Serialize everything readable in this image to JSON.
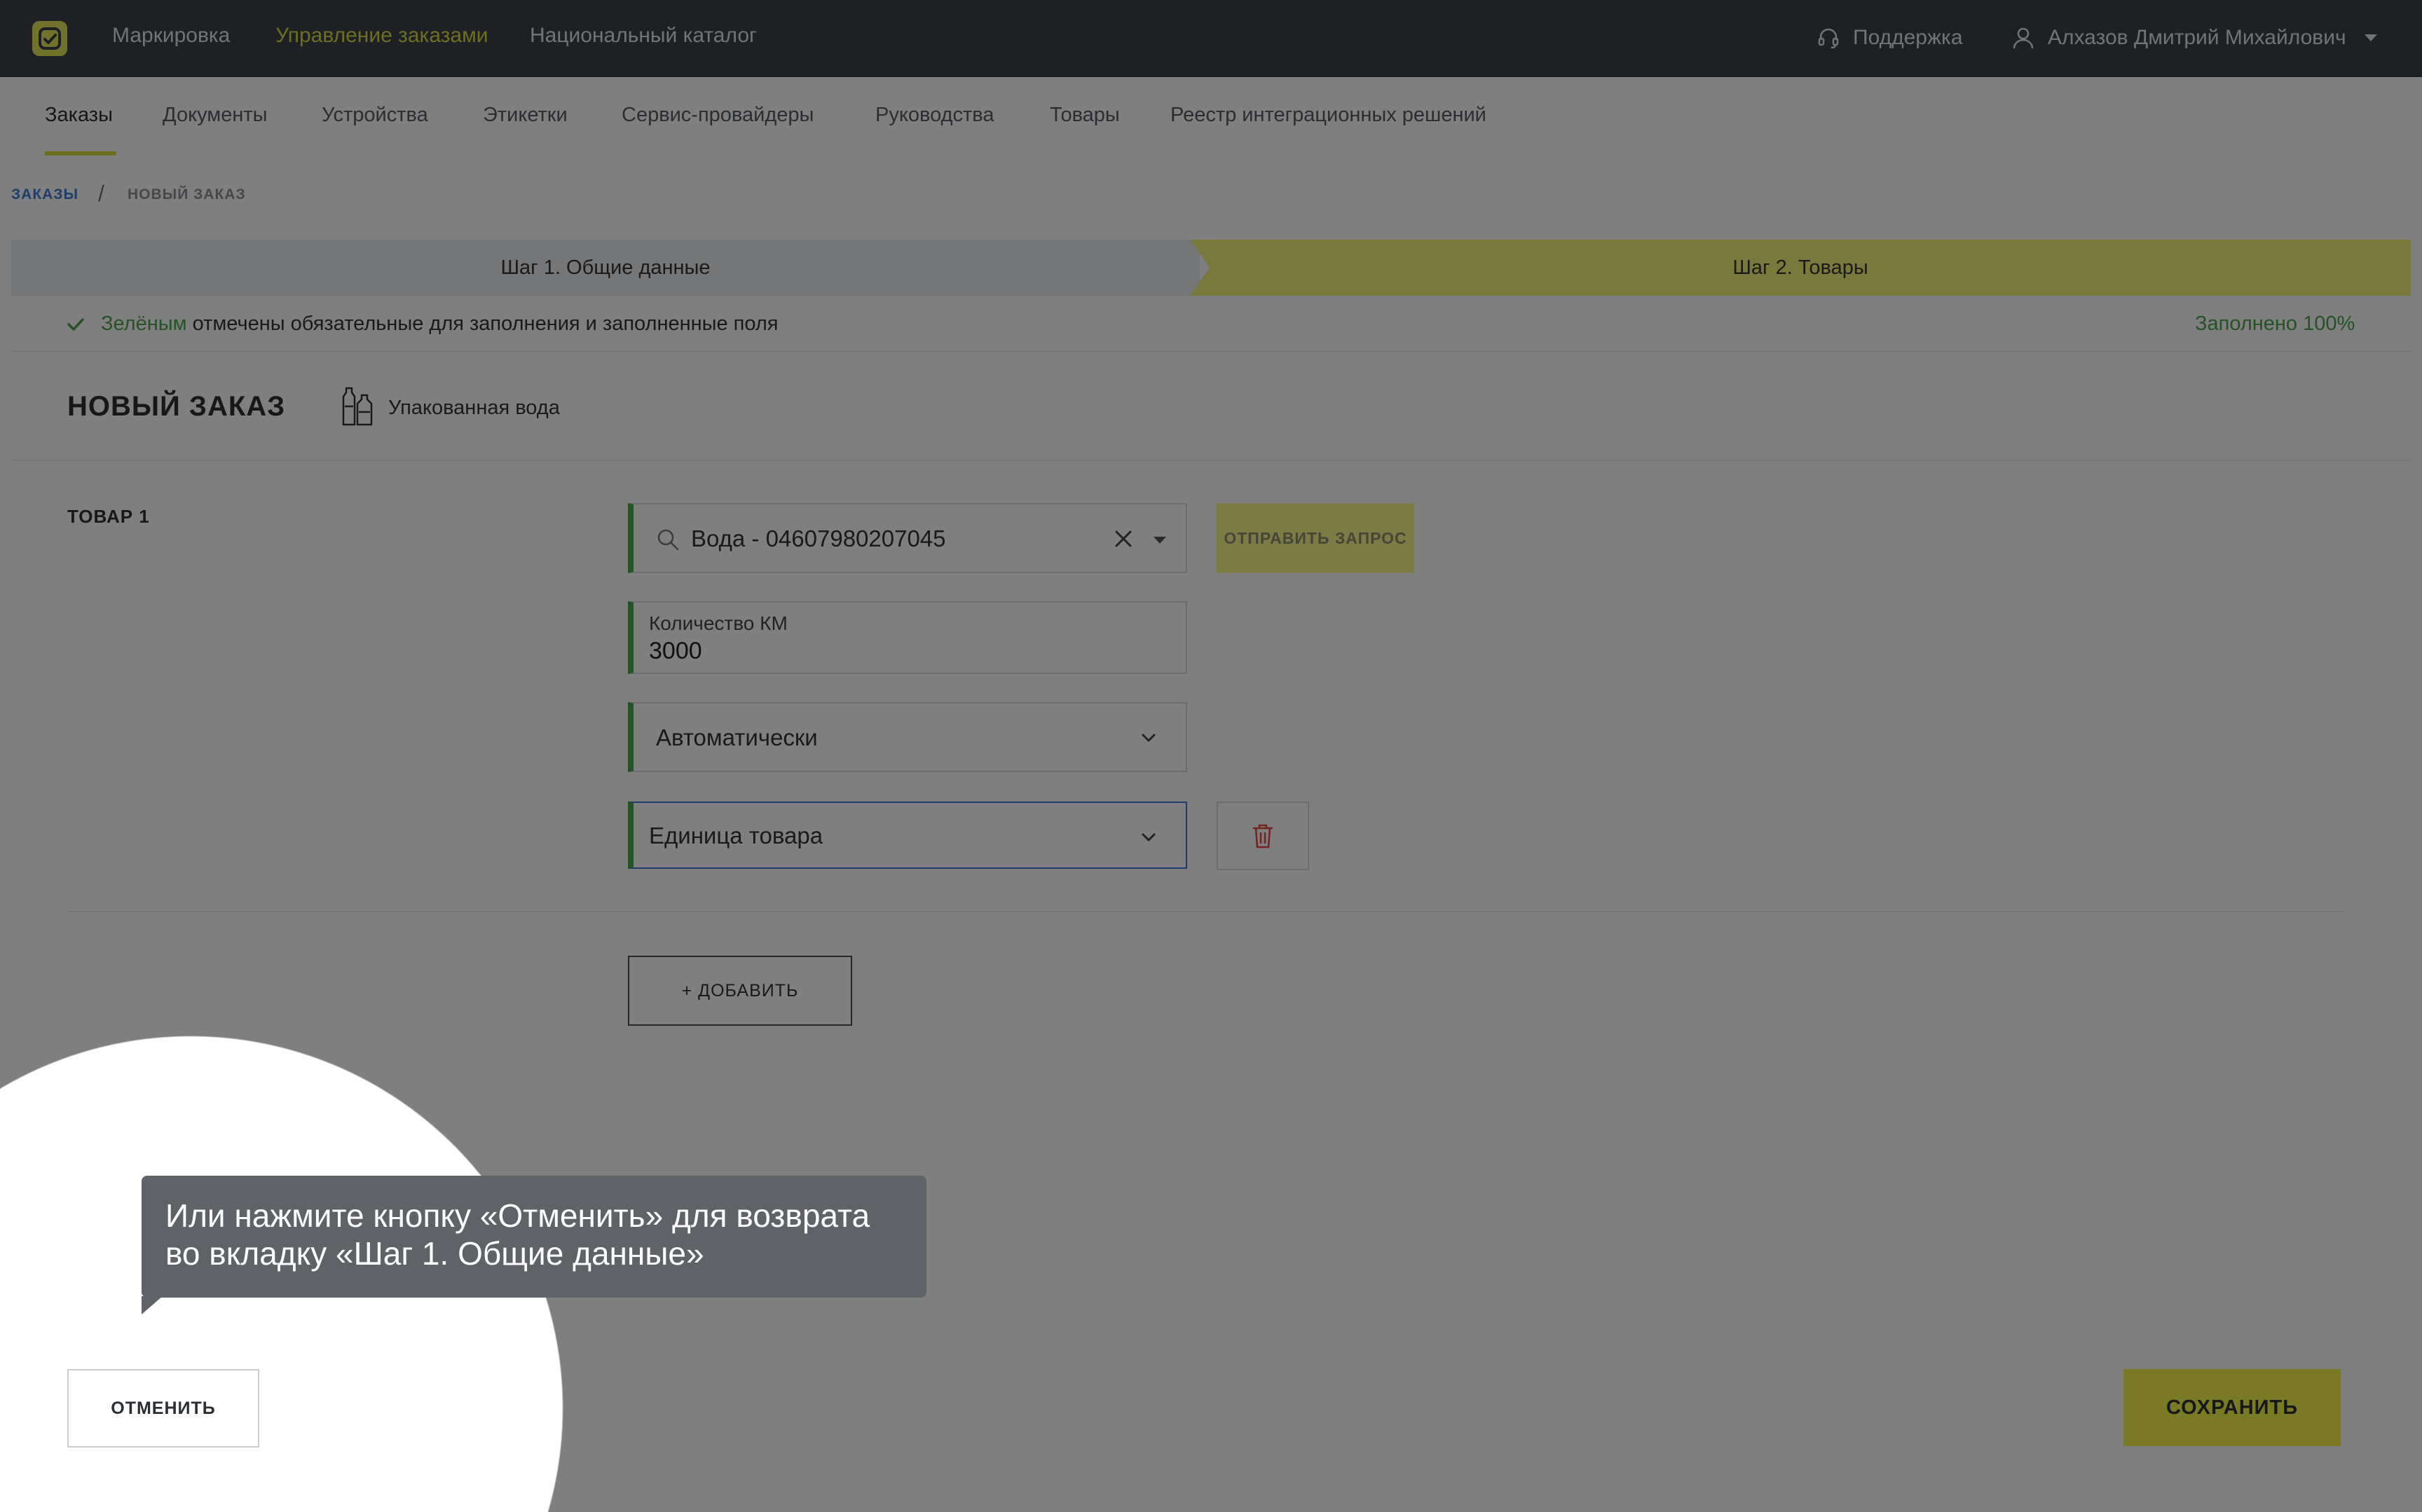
{
  "topbar": {
    "nav": [
      "Маркировка",
      "Управление заказами",
      "Национальный каталог"
    ],
    "support": "Поддержка",
    "user": "Алхазов Дмитрий Михайлович"
  },
  "subnav": {
    "tabs": [
      "Заказы",
      "Документы",
      "Устройства",
      "Этикетки",
      "Сервис-провайдеры",
      "Руководства",
      "Товары",
      "Реестр интеграционных решений"
    ]
  },
  "breadcrumb": {
    "link": "ЗАКАЗЫ",
    "separator": "/",
    "current": "НОВЫЙ ЗАКАЗ"
  },
  "steps": {
    "step1": "Шаг 1. Общие данные",
    "step2": "Шаг 2. Товары"
  },
  "hint": {
    "green_word": "Зелёным",
    "rest": " отмечены обязательные для заполнения и заполненные поля",
    "filled": "Заполнено 100%"
  },
  "order": {
    "title": "НОВЫЙ ЗАКАЗ",
    "category": "Упакованная вода"
  },
  "item": {
    "label": "ТОВАР 1",
    "product": "Вода - 04607980207045",
    "qty_label": "Количество КМ",
    "qty_value": "3000",
    "method": "Автоматически",
    "unit": "Единица товара",
    "send_label": "ОТПРАВИТЬ ЗАПРОС"
  },
  "buttons": {
    "add": "+ ДОБАВИТЬ",
    "cancel": "ОТМЕНИТЬ",
    "save": "СОХРАНИТЬ"
  },
  "tooltip": {
    "text": "Или нажмите кнопку «Отменить» для возврата во вкладку «Шаг 1. Общие данные»"
  },
  "colors": {
    "accent": "#d9df3f",
    "required_green": "#4aa64b",
    "topbar_bg": "#3b4148",
    "link_blue": "#3b7ad8"
  }
}
